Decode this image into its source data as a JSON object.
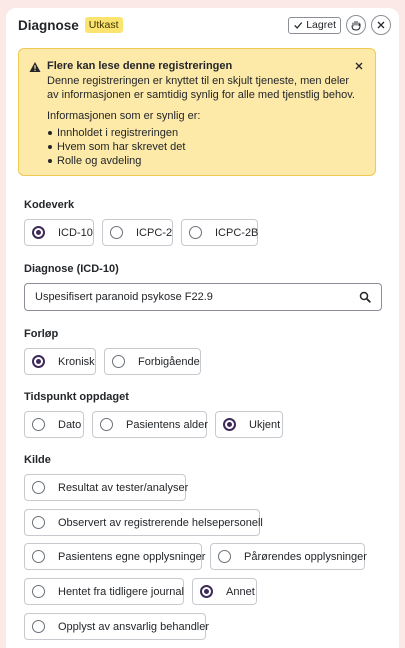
{
  "header": {
    "title": "Diagnose",
    "tag": "Utkast",
    "saved_label": "Lagret",
    "saved_icon": "check-icon",
    "hand_icon": "hand-icon",
    "close_icon": "close-icon"
  },
  "alert": {
    "title": "Flere kan lese denne registreringen",
    "body": "Denne registreringen er knyttet til en skjult tjeneste, men deler av informasjonen er samtidig synlig for alle med tjenstlig behov.",
    "sub": "Informasjonen som er synlig er:",
    "items": [
      "Innholdet i registreringen",
      "Hvem som har skrevet det",
      "Rolle og avdeling"
    ],
    "color": "#fdeaa8"
  },
  "kodeverk": {
    "label": "Kodeverk",
    "options": [
      "ICD-10",
      "ICPC-2",
      "ICPC-2B"
    ],
    "selected": "ICD-10"
  },
  "diagnose": {
    "label": "Diagnose (ICD-10)",
    "value": "Uspesifisert paranoid psykose F22.9",
    "icon": "search-icon"
  },
  "forlop": {
    "label": "Forløp",
    "options": [
      "Kronisk",
      "Forbigående"
    ],
    "selected": "Kronisk"
  },
  "tidspunkt": {
    "label": "Tidspunkt oppdaget",
    "options": [
      "Dato",
      "Pasientens alder",
      "Ukjent"
    ],
    "selected": "Ukjent"
  },
  "kilde": {
    "label": "Kilde",
    "options": [
      "Resultat av tester/analyser",
      "Observert av registrerende helsepersonell",
      "Pasientens egne opplysninger",
      "Pårørendes opplysninger",
      "Hentet fra tidligere journal",
      "Annet",
      "Opplyst av ansvarlig behandler"
    ],
    "selected": "Annet"
  },
  "colors": {
    "background": "#fbe9e7",
    "accent": "#3d2a59",
    "tag": "#fbe36f"
  }
}
